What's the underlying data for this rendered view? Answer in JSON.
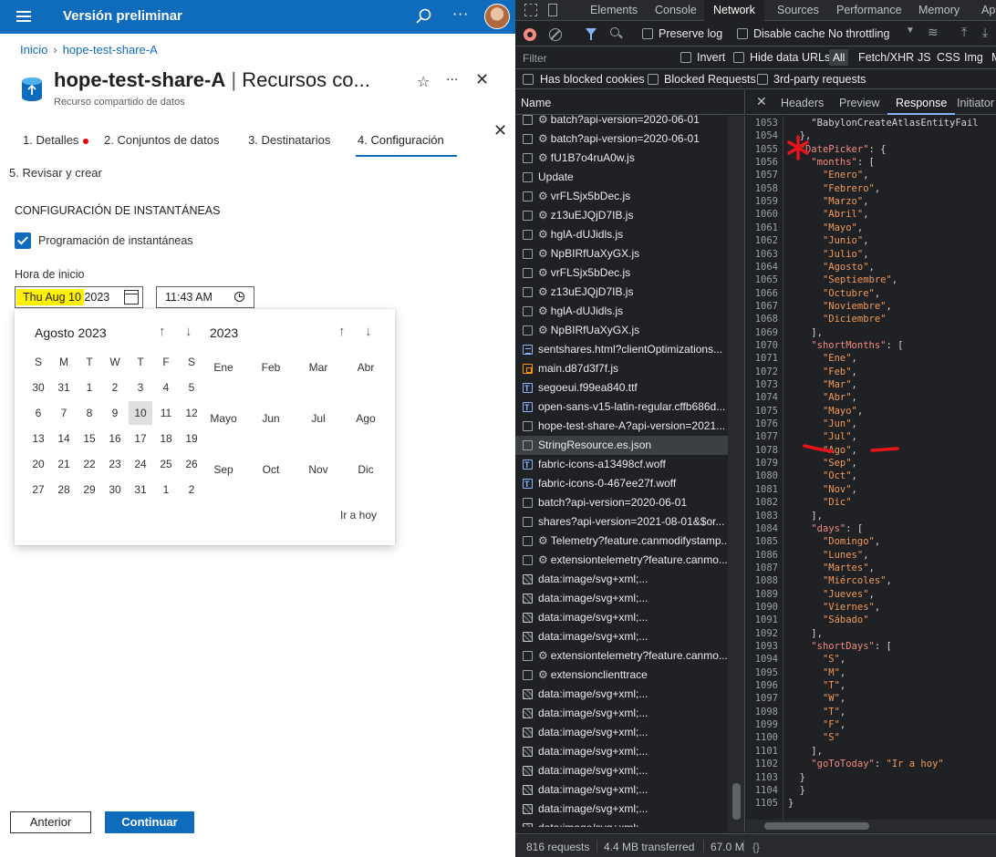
{
  "portal": {
    "title": "Versión preliminar",
    "breadcrumb": [
      "Inicio",
      "hope-test-share-A"
    ],
    "resource_name": "hope-test-share-A",
    "resource_section": "Recursos co...",
    "resource_subtitle": "Recurso compartido de datos",
    "steps": [
      {
        "label": "1. Detalles"
      },
      {
        "label": "2. Conjuntos de datos"
      },
      {
        "label": "3. Destinatarios"
      },
      {
        "label": "4. Configuración"
      },
      {
        "label": "5. Revisar y crear"
      }
    ],
    "section_title": "CONFIGURACIÓN DE INSTANTÁNEAS",
    "checkbox_label": "Programación de instantáneas",
    "start_label": "Hora de inicio",
    "date_value": "Thu Aug 10 2023",
    "time_value": "11:43  AM",
    "calendar": {
      "month_title": "Agosto 2023",
      "year_title": "2023",
      "weekdays": [
        "S",
        "M",
        "T",
        "W",
        "T",
        "F",
        "S"
      ],
      "weeks": [
        [
          "30",
          "31",
          "1",
          "2",
          "3",
          "4",
          "5"
        ],
        [
          "6",
          "7",
          "8",
          "9",
          "10",
          "11",
          "12"
        ],
        [
          "13",
          "14",
          "15",
          "16",
          "17",
          "18",
          "19"
        ],
        [
          "20",
          "21",
          "22",
          "23",
          "24",
          "25",
          "26"
        ],
        [
          "27",
          "28",
          "29",
          "30",
          "31",
          "1",
          "2"
        ]
      ],
      "months": [
        "Ene",
        "Feb",
        "Mar",
        "Abr",
        "Mayo",
        "Jun",
        "Jul",
        "Ago",
        "Sep",
        "Oct",
        "Nov",
        "Dic"
      ],
      "go_today": "Ir a hoy"
    },
    "buttons": {
      "prev": "Anterior",
      "next": "Continuar"
    },
    "colors": {
      "brand": "#0f6cbd",
      "highlight": "#fff200"
    }
  },
  "devtools": {
    "tabs": [
      "Elements",
      "Console",
      "Network",
      "Sources",
      "Performance",
      "Memory",
      "Ap"
    ],
    "toolbar": {
      "preserve_log": "Preserve log",
      "disable_cache": "Disable cache",
      "throttle": "No throttling"
    },
    "filter": {
      "placeholder": "Filter",
      "invert": "Invert",
      "hide_data_urls": "Hide data URLs",
      "all": "All",
      "types": [
        "Fetch/XHR",
        "JS",
        "CSS",
        "Img",
        "M"
      ]
    },
    "filter2": {
      "blocked_cookies": "Has blocked cookies",
      "blocked_requests": "Blocked Requests",
      "third_party": "3rd-party requests"
    },
    "list_header": "Name",
    "requests": [
      {
        "name": "batch?api-version=2020-06-01",
        "icon": "gear"
      },
      {
        "name": "batch?api-version=2020-06-01",
        "icon": "gear"
      },
      {
        "name": "fU1B7o4ruA0w.js",
        "icon": "gear"
      },
      {
        "name": "Update",
        "icon": "box"
      },
      {
        "name": "vrFLSjx5bDec.js",
        "icon": "gear"
      },
      {
        "name": "z13uEJQjD7IB.js",
        "icon": "gear"
      },
      {
        "name": "hglA-dUJidls.js",
        "icon": "gear"
      },
      {
        "name": "NpBIRfUaXyGX.js",
        "icon": "gear"
      },
      {
        "name": "vrFLSjx5bDec.js",
        "icon": "gear"
      },
      {
        "name": "z13uEJQjD7IB.js",
        "icon": "gear"
      },
      {
        "name": "hglA-dUJidls.js",
        "icon": "gear"
      },
      {
        "name": "NpBIRfUaXyGX.js",
        "icon": "gear"
      },
      {
        "name": "sentshares.html?clientOptimizations...",
        "icon": "doc"
      },
      {
        "name": "main.d87d3f7f.js",
        "icon": "js"
      },
      {
        "name": "segoeui.f99ea840.ttf",
        "icon": "font"
      },
      {
        "name": "open-sans-v15-latin-regular.cffb686d...",
        "icon": "font"
      },
      {
        "name": "hope-test-share-A?api-version=2021...",
        "icon": "box"
      },
      {
        "name": "StringResource.es.json",
        "icon": "box",
        "selected": true
      },
      {
        "name": "fabric-icons-a13498cf.woff",
        "icon": "font"
      },
      {
        "name": "fabric-icons-0-467ee27f.woff",
        "icon": "font"
      },
      {
        "name": "batch?api-version=2020-06-01",
        "icon": "box"
      },
      {
        "name": "shares?api-version=2021-08-01&$or...",
        "icon": "box"
      },
      {
        "name": "Telemetry?feature.canmodifystamp...",
        "icon": "gear"
      },
      {
        "name": "extensiontelemetry?feature.canmo...",
        "icon": "gear"
      },
      {
        "name": "data:image/svg+xml;...",
        "icon": "img"
      },
      {
        "name": "data:image/svg+xml;...",
        "icon": "img"
      },
      {
        "name": "data:image/svg+xml;...",
        "icon": "img"
      },
      {
        "name": "data:image/svg+xml;...",
        "icon": "img"
      },
      {
        "name": "extensiontelemetry?feature.canmo...",
        "icon": "gear"
      },
      {
        "name": "extensionclienttrace",
        "icon": "gear"
      },
      {
        "name": "data:image/svg+xml;...",
        "icon": "img"
      },
      {
        "name": "data:image/svg+xml;...",
        "icon": "img"
      },
      {
        "name": "data:image/svg+xml;...",
        "icon": "img"
      },
      {
        "name": "data:image/svg+xml;...",
        "icon": "img"
      },
      {
        "name": "data:image/svg+xml;...",
        "icon": "img"
      },
      {
        "name": "data:image/svg+xml;...",
        "icon": "img"
      },
      {
        "name": "data:image/svg+xml;...",
        "icon": "img"
      },
      {
        "name": "data:image/svg+xml;...",
        "icon": "img"
      }
    ],
    "response_tabs": [
      "Headers",
      "Preview",
      "Response",
      "Initiator"
    ],
    "code_lines": [
      {
        "n": "1053",
        "t": "    \"BabylonCreateAtlasEntityFail"
      },
      {
        "n": "1054",
        "t": "  },"
      },
      {
        "n": "1055",
        "t": "  \"DatePicker\": {"
      },
      {
        "n": "1056",
        "t": "    \"months\": ["
      },
      {
        "n": "1057",
        "t": "      \"Enero\","
      },
      {
        "n": "1058",
        "t": "      \"Febrero\","
      },
      {
        "n": "1059",
        "t": "      \"Marzo\","
      },
      {
        "n": "1060",
        "t": "      \"Abril\","
      },
      {
        "n": "1061",
        "t": "      \"Mayo\","
      },
      {
        "n": "1062",
        "t": "      \"Junio\","
      },
      {
        "n": "1063",
        "t": "      \"Julio\","
      },
      {
        "n": "1064",
        "t": "      \"Agosto\","
      },
      {
        "n": "1065",
        "t": "      \"Septiembre\","
      },
      {
        "n": "1066",
        "t": "      \"Octubre\","
      },
      {
        "n": "1067",
        "t": "      \"Noviembre\","
      },
      {
        "n": "1068",
        "t": "      \"Diciembre\""
      },
      {
        "n": "1069",
        "t": "    ],"
      },
      {
        "n": "1070",
        "t": "    \"shortMonths\": ["
      },
      {
        "n": "1071",
        "t": "      \"Ene\","
      },
      {
        "n": "1072",
        "t": "      \"Feb\","
      },
      {
        "n": "1073",
        "t": "      \"Mar\","
      },
      {
        "n": "1074",
        "t": "      \"Abr\","
      },
      {
        "n": "1075",
        "t": "      \"Mayo\","
      },
      {
        "n": "1076",
        "t": "      \"Jun\","
      },
      {
        "n": "1077",
        "t": "      \"Jul\","
      },
      {
        "n": "1078",
        "t": "      \"Ago\","
      },
      {
        "n": "1079",
        "t": "      \"Sep\","
      },
      {
        "n": "1080",
        "t": "      \"Oct\","
      },
      {
        "n": "1081",
        "t": "      \"Nov\","
      },
      {
        "n": "1082",
        "t": "      \"Dic\""
      },
      {
        "n": "1083",
        "t": "    ],"
      },
      {
        "n": "1084",
        "t": "    \"days\": ["
      },
      {
        "n": "1085",
        "t": "      \"Domingo\","
      },
      {
        "n": "1086",
        "t": "      \"Lunes\","
      },
      {
        "n": "1087",
        "t": "      \"Martes\","
      },
      {
        "n": "1088",
        "t": "      \"Miércoles\","
      },
      {
        "n": "1089",
        "t": "      \"Jueves\","
      },
      {
        "n": "1090",
        "t": "      \"Viernes\","
      },
      {
        "n": "1091",
        "t": "      \"Sábado\""
      },
      {
        "n": "1092",
        "t": "    ],"
      },
      {
        "n": "1093",
        "t": "    \"shortDays\": ["
      },
      {
        "n": "1094",
        "t": "      \"S\","
      },
      {
        "n": "1095",
        "t": "      \"M\","
      },
      {
        "n": "1096",
        "t": "      \"T\","
      },
      {
        "n": "1097",
        "t": "      \"W\","
      },
      {
        "n": "1098",
        "t": "      \"T\","
      },
      {
        "n": "1099",
        "t": "      \"F\","
      },
      {
        "n": "1100",
        "t": "      \"S\""
      },
      {
        "n": "1101",
        "t": "    ],"
      },
      {
        "n": "1102",
        "t": "    \"goToToday\": \"Ir a hoy\""
      },
      {
        "n": "1103",
        "t": "  }"
      },
      {
        "n": "1104",
        "t": "  }"
      },
      {
        "n": "1105",
        "t": "}"
      }
    ],
    "status": {
      "requests": "816 requests",
      "transferred": "4.4 MB transferred",
      "resources": "67.0 M"
    },
    "colors": {
      "bg": "#202124",
      "key": "#f28b82",
      "string": "#ee9a5d",
      "annotation": "#e8141b"
    }
  }
}
